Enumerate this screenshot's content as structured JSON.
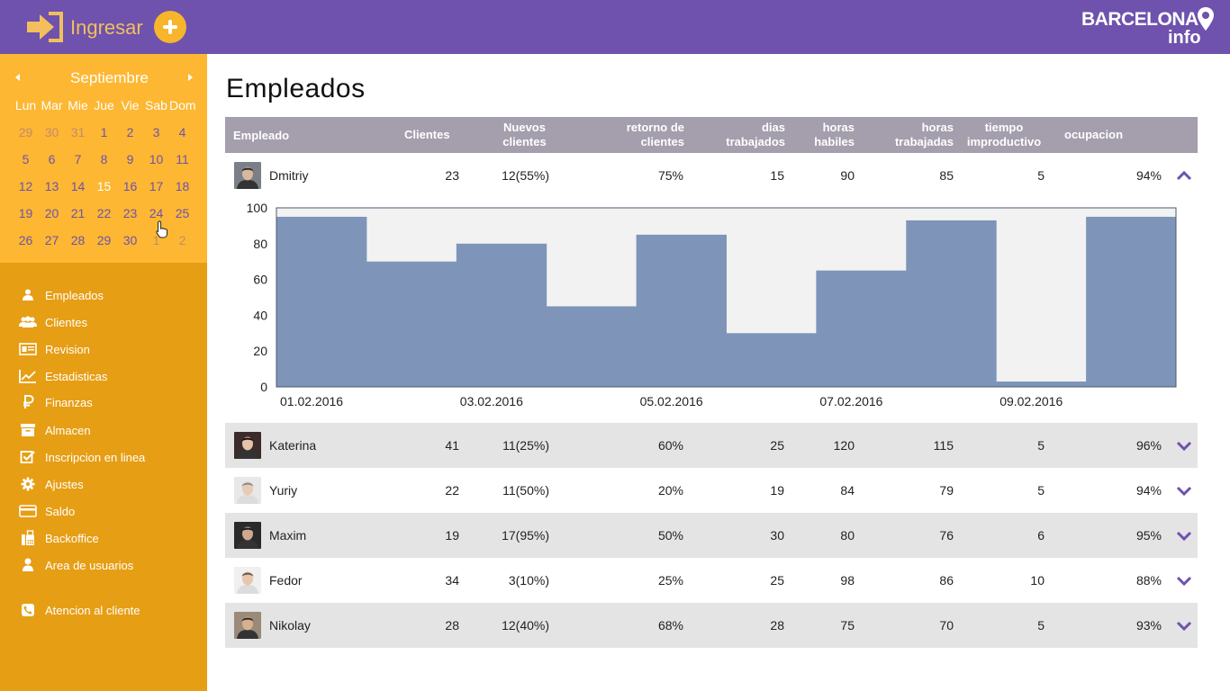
{
  "topbar": {
    "login_label": "Ingresar",
    "brand_top": "BARCELONA",
    "brand_bottom": "info",
    "bar_color": "#6e52ad",
    "accent_color": "#f7b52c"
  },
  "calendar": {
    "month": "Septiembre",
    "weekdays": [
      "Lun",
      "Mar",
      "Mie",
      "Jue",
      "Vie",
      "Sab",
      "Dom"
    ],
    "weeks": [
      [
        "29",
        "30",
        "31",
        "1",
        "2",
        "3",
        "4"
      ],
      [
        "5",
        "6",
        "7",
        "8",
        "9",
        "10",
        "11"
      ],
      [
        "12",
        "13",
        "14",
        "15",
        "16",
        "17",
        "18"
      ],
      [
        "19",
        "20",
        "21",
        "22",
        "23",
        "24",
        "25"
      ],
      [
        "26",
        "27",
        "28",
        "29",
        "30",
        "1",
        "2"
      ]
    ],
    "selected_day": "15",
    "hover_day": "24"
  },
  "menu": {
    "items": [
      {
        "label": "Empleados",
        "icon": "employees-icon"
      },
      {
        "label": "Clientes",
        "icon": "clients-icon"
      },
      {
        "label": "Revision",
        "icon": "id-card-icon"
      },
      {
        "label": "Estadisticas",
        "icon": "line-chart-icon"
      },
      {
        "label": "Finanzas",
        "icon": "ruble-icon"
      },
      {
        "label": "Almacen",
        "icon": "archive-icon"
      },
      {
        "label": "Inscripcion en linea",
        "icon": "checkbox-icon"
      },
      {
        "label": "Ajustes",
        "icon": "gear-icon"
      },
      {
        "label": "Saldo",
        "icon": "credit-card-icon"
      },
      {
        "label": "Backoffice",
        "icon": "fax-icon"
      },
      {
        "label": "Area de usuarios",
        "icon": "user-icon"
      },
      {
        "label": "Atencion al cliente",
        "icon": "phone-icon"
      }
    ]
  },
  "main": {
    "title": "Empleados",
    "columns": {
      "empleado": "Empleado",
      "clientes": "Clientes",
      "nuevos_1": "Nuevos",
      "nuevos_2": "clientes",
      "retorno_1": "retorno de",
      "retorno_2": "clientes",
      "dias_1": "dias",
      "dias_2": "trabajados",
      "horas_hab_1": "horas",
      "horas_hab_2": "habiles",
      "horas_trab_1": "horas",
      "horas_trab_2": "trabajadas",
      "tiempo_1": "tiempo",
      "tiempo_2": "improductivo",
      "ocupacion": "ocupacion"
    },
    "rows": [
      {
        "name": "Dmitriy",
        "clientes": "23",
        "nuevos": "12(55%)",
        "retorno": "75%",
        "dias": "15",
        "horas_habiles": "90",
        "horas_trabajadas": "85",
        "tiempo": "5",
        "ocupacion": "94%",
        "expanded": true
      },
      {
        "name": "Katerina",
        "clientes": "41",
        "nuevos": "11(25%)",
        "retorno": "60%",
        "dias": "25",
        "horas_habiles": "120",
        "horas_trabajadas": "115",
        "tiempo": "5",
        "ocupacion": "96%",
        "expanded": false
      },
      {
        "name": "Yuriy",
        "clientes": "22",
        "nuevos": "11(50%)",
        "retorno": "20%",
        "dias": "19",
        "horas_habiles": "84",
        "horas_trabajadas": "79",
        "tiempo": "5",
        "ocupacion": "94%",
        "expanded": false
      },
      {
        "name": "Maxim",
        "clientes": "19",
        "nuevos": "17(95%)",
        "retorno": "50%",
        "dias": "30",
        "horas_habiles": "80",
        "horas_trabajadas": "76",
        "tiempo": "6",
        "ocupacion": "95%",
        "expanded": false
      },
      {
        "name": "Fedor",
        "clientes": "34",
        "nuevos": "3(10%)",
        "retorno": "25%",
        "dias": "25",
        "horas_habiles": "98",
        "horas_trabajadas": "86",
        "tiempo": "10",
        "ocupacion": "88%",
        "expanded": false
      },
      {
        "name": "Nikolay",
        "clientes": "28",
        "nuevos": "12(40%)",
        "retorno": "68%",
        "dias": "28",
        "horas_habiles": "75",
        "horas_trabajadas": "70",
        "tiempo": "5",
        "ocupacion": "93%",
        "expanded": false
      }
    ]
  },
  "chart_data": {
    "type": "area",
    "x": [
      "01.02.2016",
      "02.02.2016",
      "03.02.2016",
      "04.02.2016",
      "05.02.2016",
      "06.02.2016",
      "07.02.2016",
      "08.02.2016",
      "09.02.2016",
      "10.02.2016"
    ],
    "x_tick_labels": [
      "01.02.2016",
      "03.02.2016",
      "05.02.2016",
      "07.02.2016",
      "09.02.2016"
    ],
    "values": [
      95,
      70,
      80,
      45,
      85,
      30,
      65,
      93,
      3,
      95
    ],
    "ylim": [
      0,
      100
    ],
    "y_ticks": [
      "0",
      "20",
      "40",
      "60",
      "80",
      "100"
    ],
    "step": true,
    "fill_color": "#7e95b9",
    "background_color": "#f2f2f2"
  }
}
